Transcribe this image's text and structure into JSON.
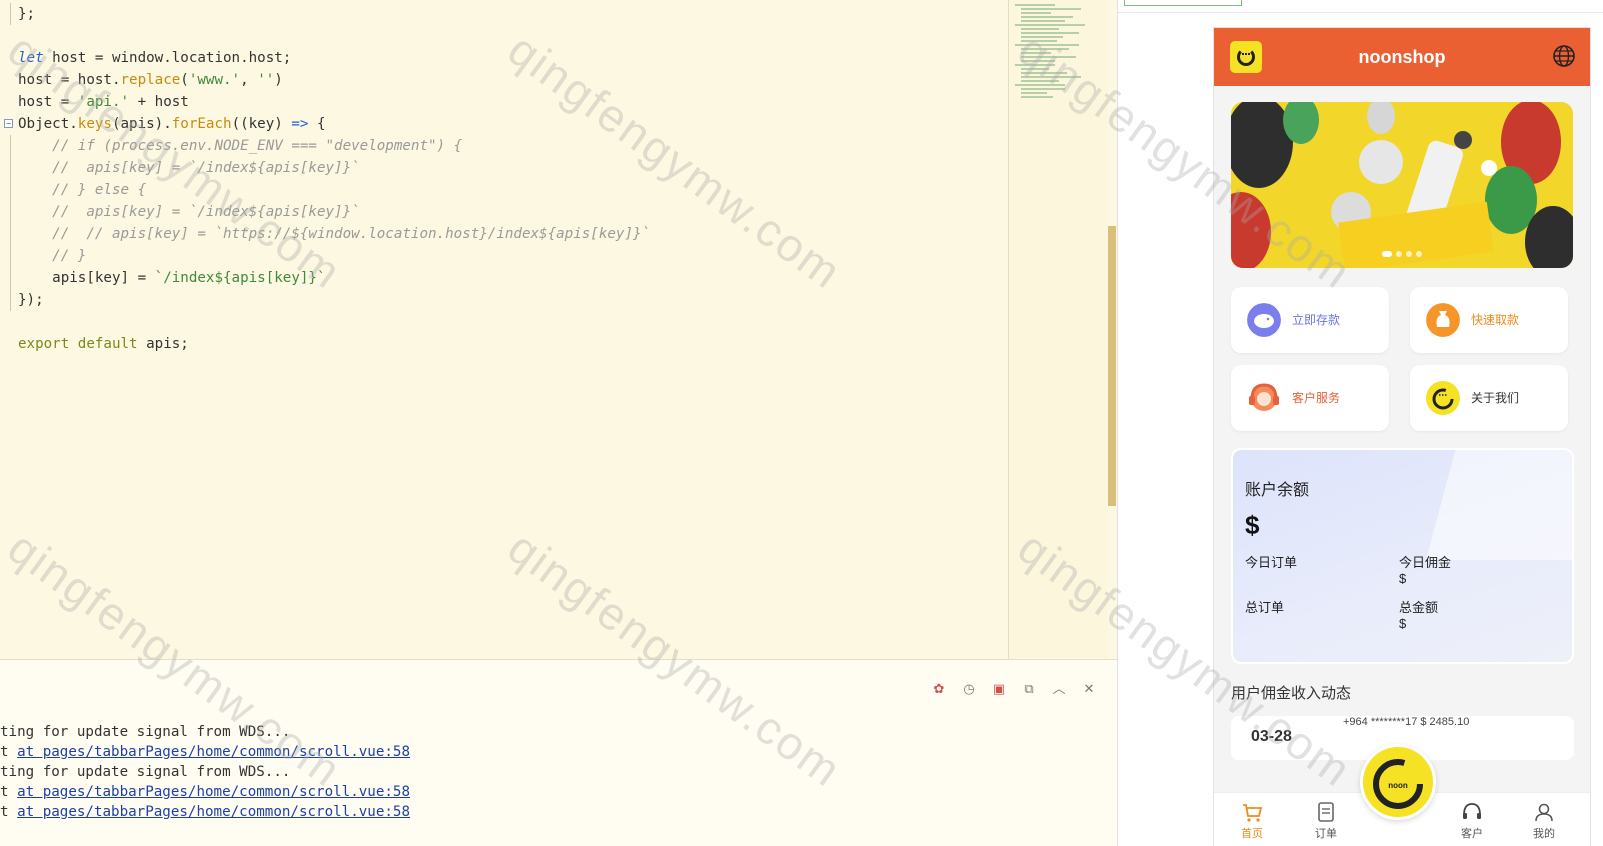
{
  "editor": {
    "lines": [
      {
        "fold": false,
        "guide": true,
        "html": "};"
      },
      {
        "fold": false,
        "guide": false,
        "html": ""
      },
      {
        "fold": false,
        "guide": false,
        "html": "<span class='kw'>let</span> host = window.location.host;"
      },
      {
        "fold": false,
        "guide": false,
        "html": "host = host.<span class='fn'>replace</span>(<span class='str'>'www.'</span>, <span class='str'>''</span>)"
      },
      {
        "fold": false,
        "guide": false,
        "html": "host = <span class='str'>'api.'</span> + host"
      },
      {
        "fold": true,
        "guide": false,
        "html": "Object.<span class='fn'>keys</span>(apis).<span class='fn'>forEach</span>((key) <span class='op'>=&gt;</span> {"
      },
      {
        "fold": false,
        "guide": true,
        "html": "    <span class='cm'>// if (process.env.NODE_ENV === \"development\") {</span>"
      },
      {
        "fold": false,
        "guide": true,
        "html": "    <span class='cm'>//  apis[key] = `/index${apis[key]}`</span>"
      },
      {
        "fold": false,
        "guide": true,
        "html": "    <span class='cm'>// } else {</span>"
      },
      {
        "fold": false,
        "guide": true,
        "html": "    <span class='cm'>//  apis[key] = `/index${apis[key]}`</span>"
      },
      {
        "fold": false,
        "guide": true,
        "html": "    <span class='cm'>//  // apis[key] = `https://${window.location.host}/index${apis[key]}`</span>"
      },
      {
        "fold": false,
        "guide": true,
        "html": "    <span class='cm'>// }</span>"
      },
      {
        "fold": false,
        "guide": true,
        "html": "    apis[key] = <span class='str'>`/index${apis[key]}`</span>"
      },
      {
        "fold": false,
        "guide": true,
        "html": "});"
      },
      {
        "fold": false,
        "guide": false,
        "html": ""
      },
      {
        "fold": false,
        "guide": false,
        "html": "<span class='kw2'>export default</span> apis;"
      }
    ]
  },
  "console": {
    "tools": [
      "bug-icon",
      "restart-icon",
      "stop-icon",
      "open-external-icon",
      "collapse-up-icon",
      "clear-icon"
    ],
    "lines": [
      {
        "prefix": "ting for update signal from WDS...",
        "link": ""
      },
      {
        "prefix": "t ",
        "link": "at pages/tabbarPages/home/common/scroll.vue:58"
      },
      {
        "prefix": "ting for update signal from WDS...",
        "link": ""
      },
      {
        "prefix": "t ",
        "link": "at pages/tabbarPages/home/common/scroll.vue:58"
      },
      {
        "prefix": "t ",
        "link": "at pages/tabbarPages/home/common/scroll.vue:58"
      }
    ]
  },
  "app": {
    "title": "noonshop",
    "quick": [
      {
        "label": "立即存款",
        "color": "#6b74e8",
        "icon": "piggy-bank-icon"
      },
      {
        "label": "快速取款",
        "color": "#f08a1c",
        "icon": "money-bag-icon"
      },
      {
        "label": "客户服务",
        "color": "#e8603a",
        "icon": "headset-icon"
      },
      {
        "label": "关于我们",
        "color": "#333333",
        "icon": "noon-logo-icon"
      }
    ],
    "balance": {
      "title": "账户余额",
      "currency": "$",
      "today_orders": "今日订单",
      "today_commission": "今日佣金",
      "today_commission_value": "$",
      "total_orders": "总订单",
      "total_amount": "总金额",
      "total_amount_value": "$"
    },
    "income": {
      "title": "用户佣金收入动态",
      "date": "03-28",
      "info": "+964 ********17 $ 2485.10"
    },
    "tabs": [
      {
        "label": "首页",
        "icon": "cart-icon",
        "active": true
      },
      {
        "label": "订单",
        "icon": "orders-icon",
        "active": false
      },
      {
        "label": "客户",
        "icon": "support-icon",
        "active": false
      },
      {
        "label": "我的",
        "icon": "profile-icon",
        "active": false
      }
    ]
  },
  "watermark": "qingfengymw.com"
}
